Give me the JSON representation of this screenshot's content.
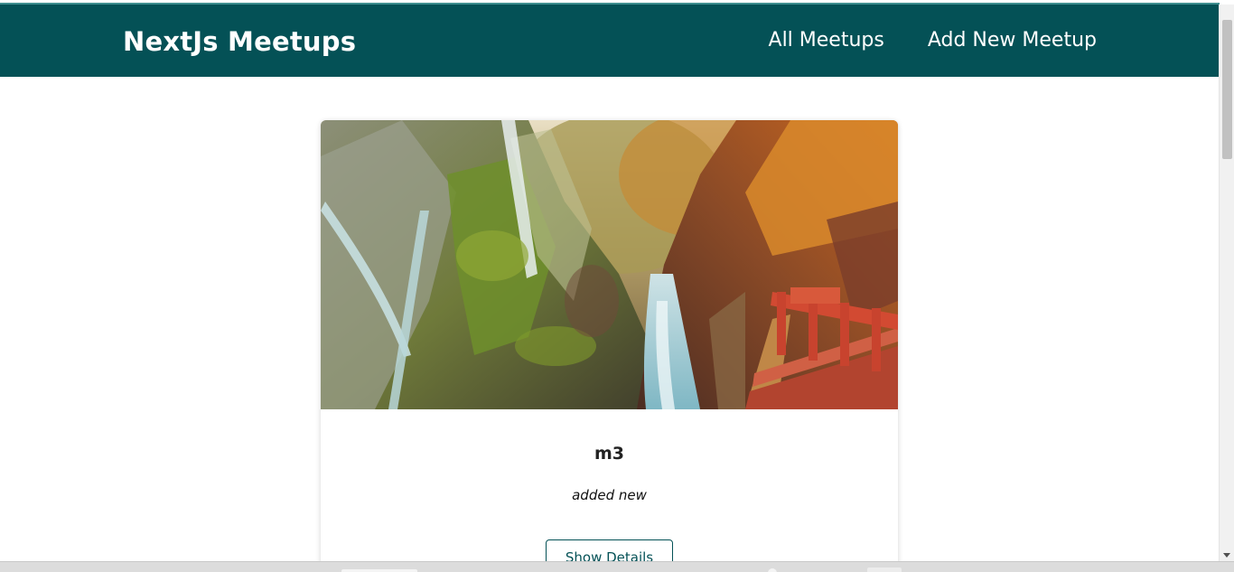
{
  "header": {
    "logo": "NextJs Meetups",
    "nav": [
      {
        "label": "All Meetups"
      },
      {
        "label": "Add New Meetup"
      }
    ]
  },
  "meetup": {
    "title": "m3",
    "description": "added new",
    "button_label": "Show Details"
  },
  "colors": {
    "header_bg": "#045156",
    "header_text": "#ffffff",
    "button_border": "#045156"
  }
}
